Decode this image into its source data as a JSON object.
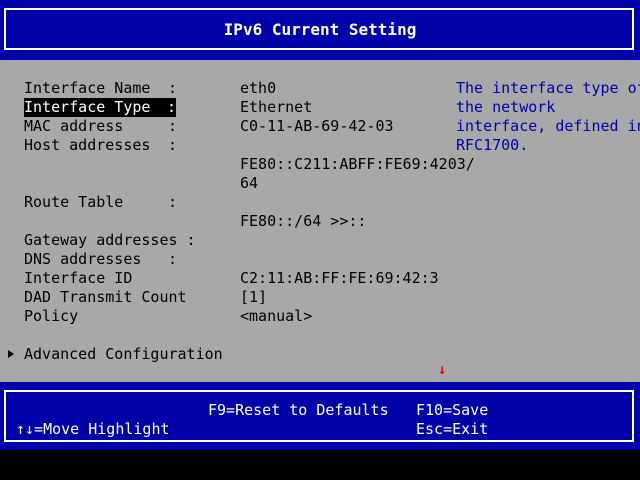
{
  "title": "IPv6 Current Setting",
  "fields": {
    "interface_name": {
      "label": "Interface Name",
      "colon": ":",
      "value": "eth0"
    },
    "interface_type": {
      "label": "Interface Type",
      "colon": ":",
      "value": "Ethernet"
    },
    "mac_address": {
      "label": "MAC address",
      "colon": ":",
      "value": "C0-11-AB-69-42-03"
    },
    "host_addresses": {
      "label": "Host addresses",
      "colon": ":",
      "value_line1": "FE80::C211:ABFF:FE69:4203/",
      "value_line2": "64"
    },
    "route_table": {
      "label": "Route Table",
      "colon": ":",
      "value": "FE80::/64 >>::"
    },
    "gateway_addresses": {
      "label": "Gateway addresses :"
    },
    "dns_addresses": {
      "label": "DNS addresses",
      "colon": ":"
    },
    "interface_id": {
      "label": "Interface ID",
      "value": "C2:11:AB:FF:FE:69:42:3"
    },
    "dad_transmit_count": {
      "label": "DAD Transmit Count",
      "value": "[1]"
    },
    "policy": {
      "label": "Policy",
      "value": "<manual>"
    },
    "advanced_configuration": {
      "label": "Advanced Configuration"
    }
  },
  "help": {
    "lines": [
      "The interface type of",
      "the network",
      "interface, defined in",
      "RFC1700."
    ]
  },
  "scroll_indicator": "↓",
  "footer": {
    "reset": "F9=Reset to Defaults",
    "save": "F10=Save",
    "move": "↑↓=Move Highlight",
    "exit": "Esc=Exit"
  },
  "colors": {
    "blue": "#0000a8",
    "gray": "#a8a8a8",
    "white": "#ffffff",
    "black": "#000000",
    "red": "#e80000"
  }
}
